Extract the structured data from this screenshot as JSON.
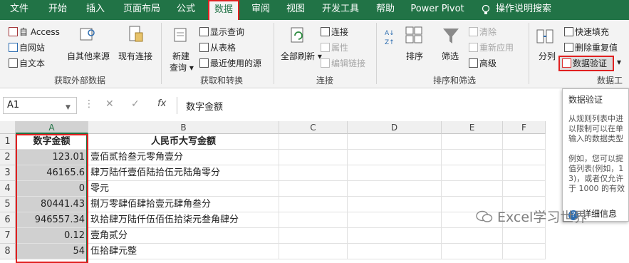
{
  "tabs": [
    "文件",
    "开始",
    "插入",
    "页面布局",
    "公式",
    "数据",
    "审阅",
    "视图",
    "开发工具",
    "帮助",
    "Power Pivot",
    "操作说明搜索"
  ],
  "active_tab": "数据",
  "ribbon": {
    "get_external": {
      "access": "自 Access",
      "web": "自网站",
      "text": "自文本",
      "other": "自其他来源",
      "existing": "现有连接",
      "label": "获取外部数据"
    },
    "get_transform": {
      "new_query": "新建",
      "new_query2": "查询",
      "show_queries": "显示查询",
      "from_table": "从表格",
      "recent": "最近使用的源",
      "label": "获取和转换"
    },
    "connections": {
      "refresh_all": "全部刷新",
      "connections": "连接",
      "properties": "属性",
      "edit_links": "编辑链接",
      "label": "连接"
    },
    "sort_filter": {
      "sort": "排序",
      "filter": "筛选",
      "clear": "清除",
      "reapply": "重新应用",
      "advanced": "高级",
      "label": "排序和筛选"
    },
    "data_tools": {
      "split": "分列",
      "flash_fill": "快速填充",
      "remove_dup": "删除重复值",
      "data_validation": "数据验证",
      "label": "数据工"
    }
  },
  "formula_bar": {
    "name_box": "A1",
    "fx": "fx",
    "formula": "数字金额"
  },
  "columns": [
    "A",
    "B",
    "C",
    "D",
    "E",
    "F"
  ],
  "rows": [
    {
      "num": "1",
      "a": "数字金额",
      "b": "人民币大写金额"
    },
    {
      "num": "2",
      "a": "123.01",
      "b": "壹佰贰拾叁元零角壹分"
    },
    {
      "num": "3",
      "a": "46165.6",
      "b": "肆万陆仟壹佰陆拾伍元陆角零分"
    },
    {
      "num": "4",
      "a": "0",
      "b": "零元"
    },
    {
      "num": "5",
      "a": "80441.43",
      "b": "捌万零肆佰肆拾壹元肆角叁分"
    },
    {
      "num": "6",
      "a": "946557.34",
      "b": "玖拾肆万陆仟伍佰伍拾柒元叁角肆分"
    },
    {
      "num": "7",
      "a": "0.12",
      "b": "壹角贰分"
    },
    {
      "num": "8",
      "a": "54",
      "b": "伍拾肆元整"
    }
  ],
  "tooltip": {
    "title": "数据验证",
    "lines1": [
      "从规则列表中进",
      "以限制可以在单",
      "输入的数据类型"
    ],
    "lines2": [
      "例如，您可以提",
      "值列表(例如，1",
      "3)，或者仅允许",
      "于 1000 的有效"
    ],
    "more": "详细信息"
  },
  "watermark": "Excel学习世界"
}
